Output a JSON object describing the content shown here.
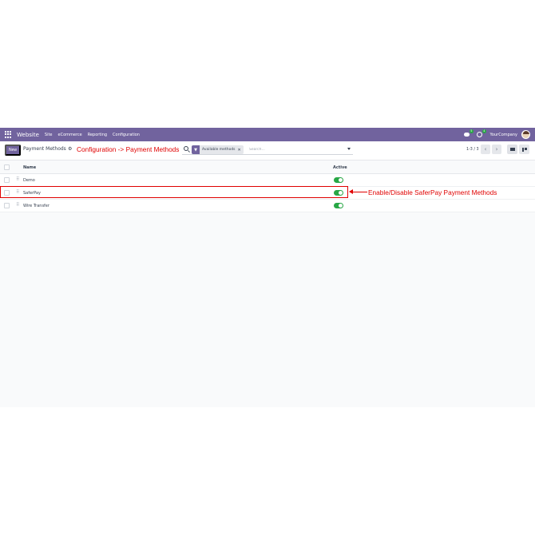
{
  "navbar": {
    "brand": "Website",
    "menu": [
      "Site",
      "eCommerce",
      "Reporting",
      "Configuration"
    ],
    "messages_count": "5",
    "activities_count": "4",
    "company": "YourCompany"
  },
  "control_panel": {
    "new_label": "New",
    "breadcrumb": "Payment Methods",
    "facet_label": "Available methods",
    "search_placeholder": "Search...",
    "pager": "1-3 / 3"
  },
  "list": {
    "columns": {
      "name": "Name",
      "active": "Active"
    },
    "rows": [
      {
        "name": "Demo",
        "active": true
      },
      {
        "name": "SaferPay",
        "active": true
      },
      {
        "name": "Wire Transfer",
        "active": true
      }
    ]
  },
  "annotations": {
    "config_path": "Configuration -> Payment Methods",
    "toggle_note": "Enable/Disable SaferPay Payment Methods"
  },
  "colors": {
    "brand": "#71639e",
    "toggle_on": "#28a745",
    "annotation": "#e00000"
  }
}
